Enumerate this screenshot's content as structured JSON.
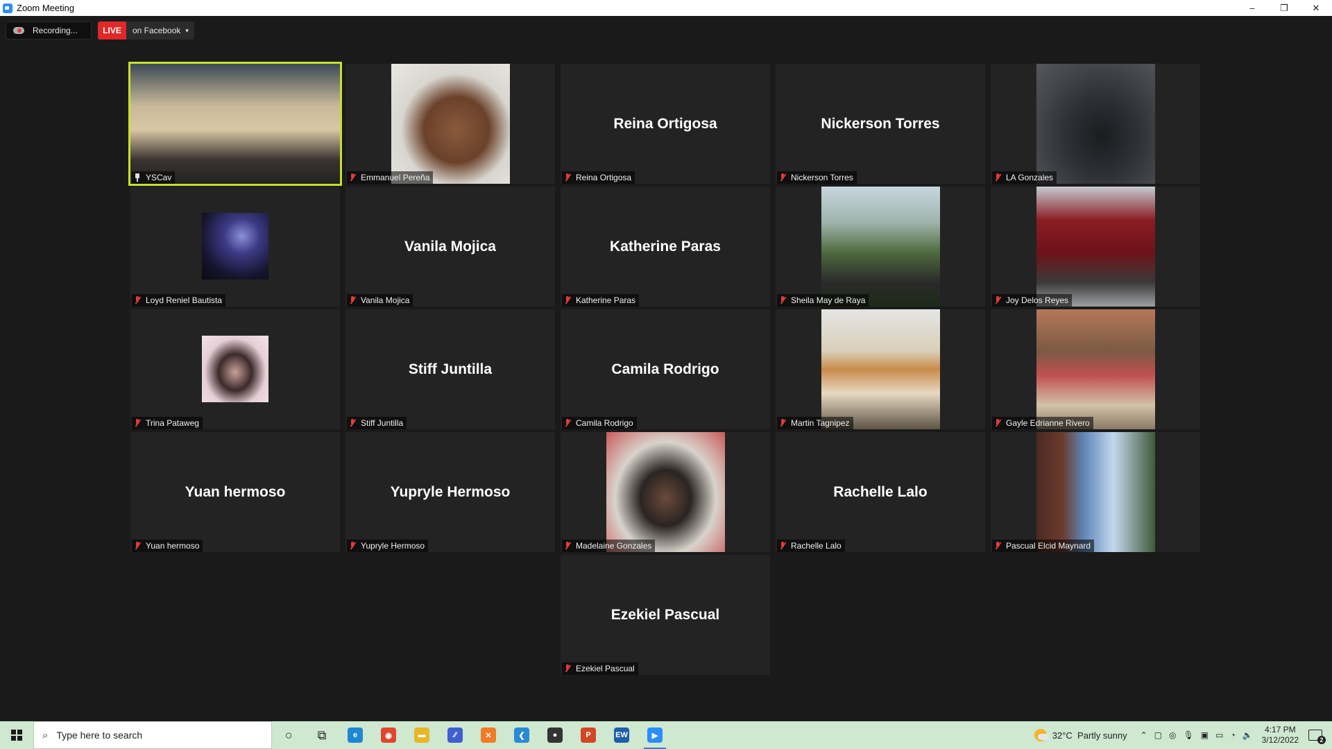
{
  "window": {
    "title": "Zoom Meeting",
    "minimize": "–",
    "restore": "❐",
    "close": "✕"
  },
  "toolbar": {
    "recording_label": "Recording...",
    "live_badge": "LIVE",
    "live_target": "on Facebook",
    "live_caret": "▾"
  },
  "participants": [
    {
      "name": "YSCav",
      "type": "video",
      "active": true
    },
    {
      "name": "Emmanuel Pereña",
      "type": "video"
    },
    {
      "name": "Reina Ortigosa",
      "type": "name"
    },
    {
      "name": "Nickerson Torres",
      "type": "name"
    },
    {
      "name": "LA Gonzales",
      "type": "video"
    },
    {
      "name": "Loyd Reniel Bautista",
      "type": "avatar"
    },
    {
      "name": "Vanila Mojica",
      "type": "name"
    },
    {
      "name": "Katherine Paras",
      "type": "name"
    },
    {
      "name": "Sheila May de Raya",
      "type": "video"
    },
    {
      "name": "Joy Delos Reyes",
      "type": "video"
    },
    {
      "name": "Trina Pataweg",
      "type": "avatar"
    },
    {
      "name": "Stiff Juntilla",
      "type": "name"
    },
    {
      "name": "Camila Rodrigo",
      "type": "name"
    },
    {
      "name": "Martin Tagnipez",
      "type": "video"
    },
    {
      "name": "Gayle Edrianne Rivero",
      "type": "video"
    },
    {
      "name": "Yuan hermoso",
      "type": "name"
    },
    {
      "name": "Yupryle Hermoso",
      "type": "name"
    },
    {
      "name": "Madelaine Gonzales",
      "type": "video"
    },
    {
      "name": "Rachelle Lalo",
      "type": "name"
    },
    {
      "name": "Pascual Elcid Maynard",
      "type": "video"
    },
    {
      "name": "Ezekiel Pascual",
      "type": "name"
    }
  ],
  "taskbar": {
    "search_placeholder": "Type here to search",
    "apps": [
      {
        "name": "cortana",
        "glyph": "○",
        "color": "#222222"
      },
      {
        "name": "task-view",
        "glyph": "⧉",
        "color": "#222222"
      },
      {
        "name": "edge",
        "glyph": "e",
        "color": "#1f86d1"
      },
      {
        "name": "chrome",
        "glyph": "◉",
        "color": "#e0452f"
      },
      {
        "name": "file-explorer",
        "glyph": "▬",
        "color": "#e7b62a"
      },
      {
        "name": "visual-app",
        "glyph": "⁄⁄",
        "color": "#3f5fd1"
      },
      {
        "name": "xampp",
        "glyph": "✕",
        "color": "#f07b27"
      },
      {
        "name": "vscode",
        "glyph": "❮",
        "color": "#2a8ad6"
      },
      {
        "name": "obs",
        "glyph": "●",
        "color": "#333333"
      },
      {
        "name": "powerpoint",
        "glyph": "P",
        "color": "#d24726"
      },
      {
        "name": "easyworship",
        "glyph": "EW",
        "color": "#1d5fa8"
      },
      {
        "name": "zoom",
        "glyph": "▶",
        "color": "#2d8cff",
        "active": true
      }
    ],
    "weather_temp": "32°C",
    "weather_desc": "Partly sunny",
    "time": "4:17 PM",
    "date": "3/12/2022",
    "notification_count": "2"
  }
}
